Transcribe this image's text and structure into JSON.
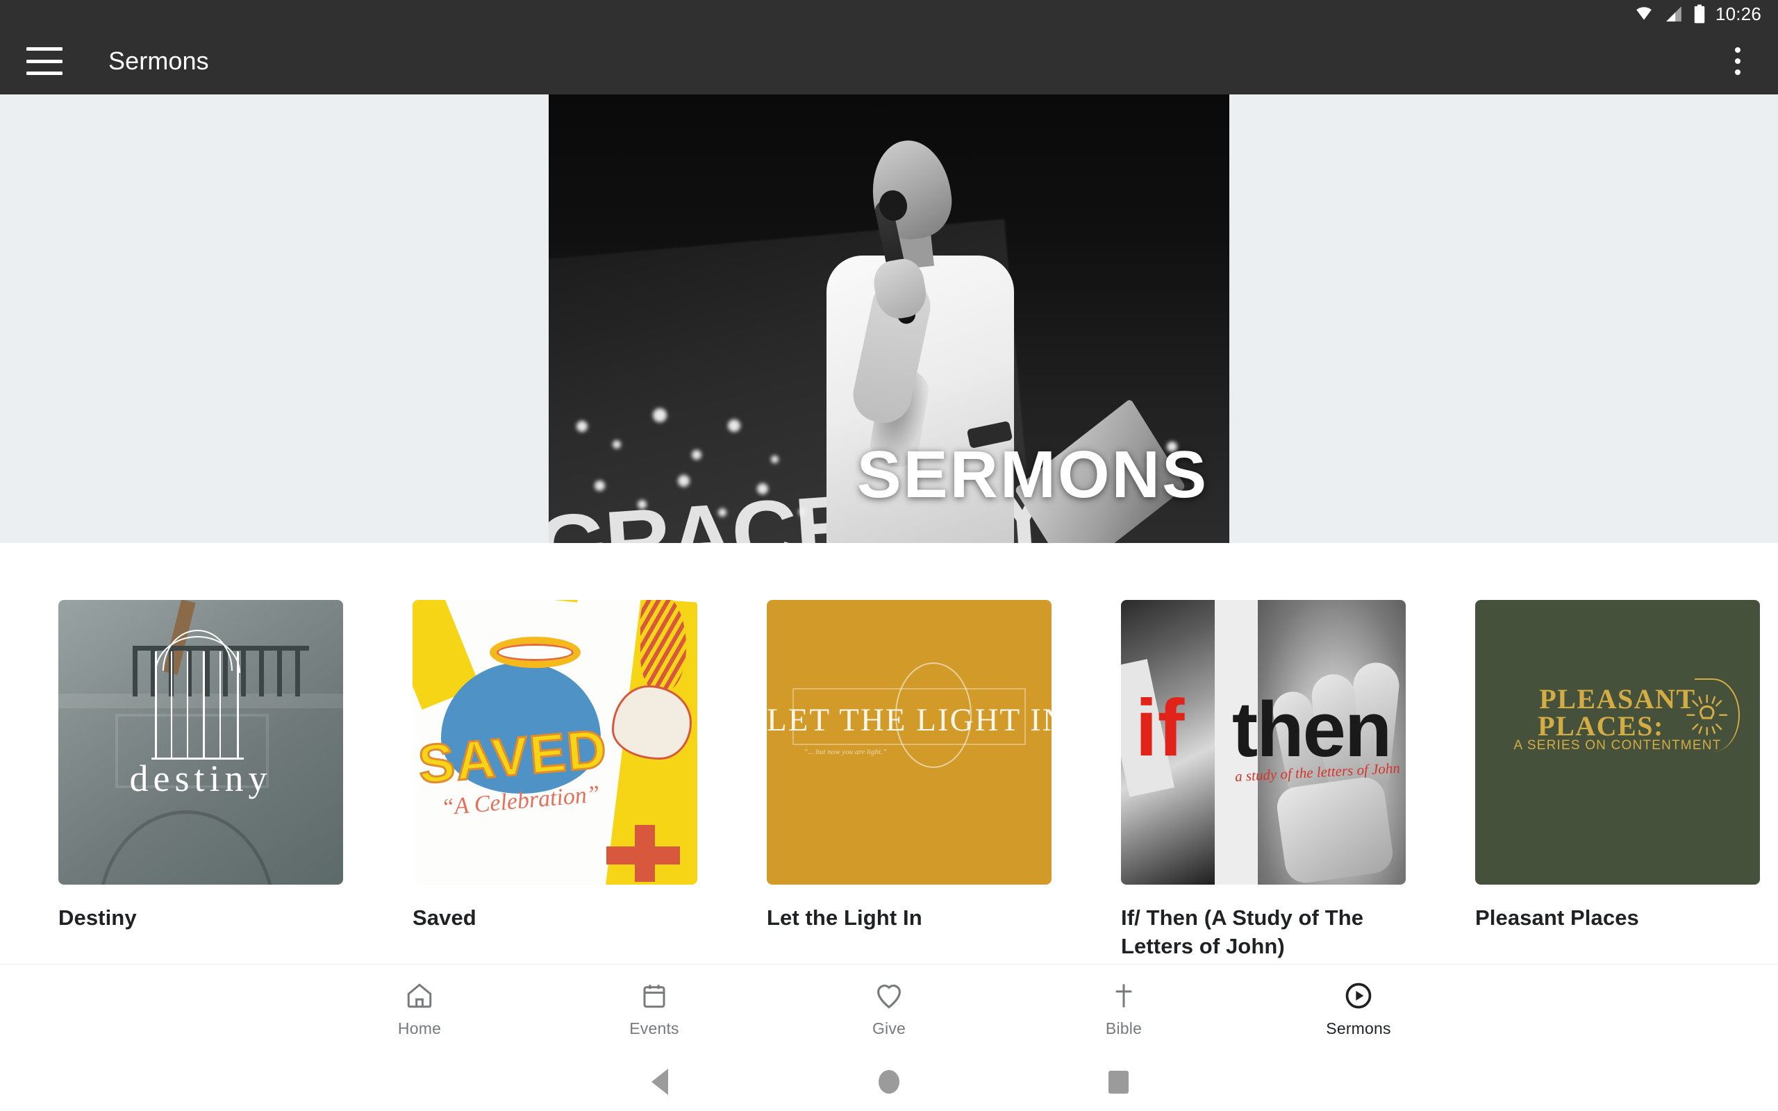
{
  "status_bar": {
    "time": "10:26",
    "icons": [
      "wifi-icon",
      "cellular-signal-icon",
      "battery-icon"
    ]
  },
  "app_bar": {
    "menu_icon": "hamburger-menu-icon",
    "title": "Sermons",
    "overflow_icon": "overflow-menu-icon"
  },
  "hero": {
    "overlay_title": "SERMONS",
    "background_text": "GRACECITY",
    "description": "Black and white photo of a speaker holding a microphone on stage"
  },
  "series": [
    {
      "title": "Destiny",
      "art": {
        "word": "destiny",
        "bg_color": "#6e7878",
        "style": "greyscale church interior with white arch line art"
      }
    },
    {
      "title": "Saved",
      "art": {
        "word": "SAVED",
        "subtitle": "“A Celebration”",
        "bg_color": "#fdfdfb",
        "accent_yellow": "#f5d515",
        "accent_blue": "#4e92c6",
        "accent_red": "#d8583d"
      }
    },
    {
      "title": "Let the Light In",
      "art": {
        "word": "LET THE LIGHT IN",
        "subtitle": "“... but now you are light.”",
        "bg_color": "#d29a28"
      }
    },
    {
      "title": "If/ Then (A Study of The Letters of John)",
      "art": {
        "word_if": "if",
        "word_then": "then",
        "subtitle": "a study of the letters of John",
        "bg_color": "#efefef",
        "accent_red": "#e2231a"
      }
    },
    {
      "title": "Pleasant Places",
      "art": {
        "line1": "PLEASANT",
        "line2": "PLACES:",
        "line3": "A SERIES ON CONTENTMENT",
        "bg_color": "#46513b",
        "accent_gold": "#d3ac44"
      }
    }
  ],
  "bottom_nav": {
    "items": [
      {
        "label": "Home",
        "icon": "home-icon",
        "active": false
      },
      {
        "label": "Events",
        "icon": "calendar-icon",
        "active": false
      },
      {
        "label": "Give",
        "icon": "heart-icon",
        "active": false
      },
      {
        "label": "Bible",
        "icon": "cross-icon",
        "active": false
      },
      {
        "label": "Sermons",
        "icon": "play-circle-icon",
        "active": true
      }
    ]
  },
  "system_nav": {
    "back": "back-triangle-icon",
    "home": "home-circle-icon",
    "recents": "recents-square-icon"
  }
}
